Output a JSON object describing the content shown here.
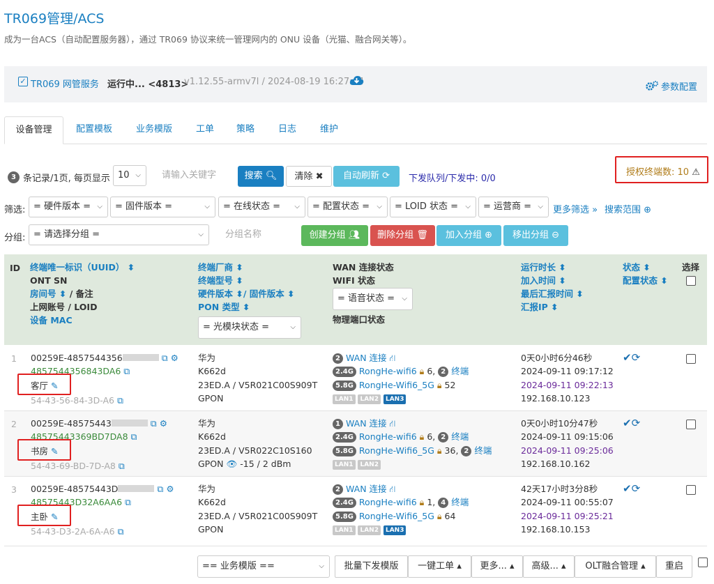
{
  "page": {
    "title": "TR069管理/ACS",
    "subtitle": "成为一台ACS（自动配置服务器），通过 TR069 协议来统一管理网内的 ONU 设备（光猫、融合网关等）。"
  },
  "service": {
    "name": "TR069 网管服务",
    "state": "运行中... <4813>",
    "version": "v1.12.55-armv7l / 2024-08-19 16:27:44",
    "param_label": "参数配置"
  },
  "tabs": [
    "设备管理",
    "配置模板",
    "业务模版",
    "工单",
    "策略",
    "日志",
    "维护"
  ],
  "toolbar": {
    "record_count": "3",
    "record_text": "条记录/1页, 每页显示",
    "page_size": "10",
    "keyword_placeholder": "请输入关键字",
    "search_label": "搜索",
    "clear_label": "清除",
    "auto_refresh_label": "自动刷新",
    "queue_label": "下发队列/下发中: 0/0",
    "license_label": "授权终端数: 10"
  },
  "filters": {
    "label": "筛选:",
    "hw": "= 硬件版本 =",
    "fw": "= 固件版本 =",
    "online": "= 在线状态 =",
    "config": "= 配置状态 =",
    "loid": "= LOID 状态 =",
    "isp": "= 运营商 =",
    "more": "更多筛选 »",
    "range": "搜索范围"
  },
  "groups": {
    "label": "分组:",
    "select": "= 请选择分组 =",
    "name_placeholder": "分组名称",
    "create": "创建分组",
    "delete": "删除分组",
    "join": "加入分组",
    "leave": "移出分组"
  },
  "header": {
    "id": "ID",
    "c1": [
      "终端唯一标识（UUID）",
      "ONT SN",
      "房间号",
      "/ 备注",
      "上网账号 / LOID",
      "设备 MAC"
    ],
    "c2": [
      "终端厂商",
      "终端型号",
      "硬件版本",
      "/ 固件版本",
      "PON 类型",
      "= 光模块状态 ="
    ],
    "c3": [
      "WAN 连接状态",
      "WIFI 状态",
      "= 语音状态 =",
      "物理端口状态"
    ],
    "c4": [
      "运行时长",
      "加入时间",
      "最后汇报时间",
      "汇报IP"
    ],
    "c5": [
      "状态",
      "配置状态"
    ],
    "select": "选择"
  },
  "rows": [
    {
      "idx": "1",
      "uuid": "00259E-4857544356",
      "sn": "4857544356843DA6",
      "room": "客厅",
      "mac": "54-43-56-84-3D-A6",
      "vendor": "华为",
      "model": "K662d",
      "ver": "23ED.A / V5R021C00S909T",
      "pon": "GPON",
      "wan_count": "2",
      "wan_label": "WAN 连接",
      "wifi24_ssid": "RongHe-wifi6",
      "wifi24_n": "6",
      "wifi24_term_n": "2",
      "term_label": "终端",
      "wifi5_ssid": "RongHe-Wifi6_5G",
      "wifi5_n": "52",
      "lans": [
        "LAN1",
        "LAN2",
        "LAN3"
      ],
      "lan_on": [
        false,
        false,
        true
      ],
      "uptime": "0天0小时6分46秒",
      "joined": "2024-09-11 09:17:12",
      "last": "2024-09-11 09:22:13",
      "ip": "192.168.10.123"
    },
    {
      "idx": "2",
      "uuid": "00259E-48575443",
      "sn": "48575443369BD7DA8",
      "room": "书房",
      "mac": "54-43-69-BD-7D-A8",
      "vendor": "华为",
      "model": "K662d",
      "ver": "23ED.A / V5R022C10S160",
      "pon": "GPON",
      "optical": "-15 / 2 dBm",
      "wan_count": "1",
      "wan_label": "WAN 连接",
      "wifi24_ssid": "RongHe-wifi6",
      "wifi24_n": "6",
      "wifi24_term_n": "2",
      "term_label": "终端",
      "wifi5_ssid": "RongHe-Wifi6_5G",
      "wifi5_n": "36",
      "wifi5_term_n": "2",
      "lans": [
        "LAN1",
        "LAN2"
      ],
      "lan_on": [
        false,
        false
      ],
      "uptime": "0天0小时10分47秒",
      "joined": "2024-09-11 09:15:06",
      "last": "2024-09-11 09:25:06",
      "ip": "192.168.10.162"
    },
    {
      "idx": "3",
      "uuid": "00259E-48575443D",
      "sn": "48575443D32A6AA6",
      "room": "主卧",
      "mac": "54-43-D3-2A-6A-A6",
      "vendor": "华为",
      "model": "K662d",
      "ver": "23ED.A / V5R021C00S909T",
      "pon": "GPON",
      "wan_count": "2",
      "wan_label": "WAN 连接",
      "wifi24_ssid": "RongHe-wifi6",
      "wifi24_n": "1",
      "wifi24_term_n": "4",
      "term_label": "终端",
      "wifi5_ssid": "RongHe-Wifi6_5G",
      "wifi5_n": "64",
      "lans": [
        "LAN1",
        "LAN2",
        "LAN3"
      ],
      "lan_on": [
        false,
        false,
        true
      ],
      "uptime": "42天17小时3分8秒",
      "joined": "2024-09-11 00:55:07",
      "last": "2024-09-11 09:25:21",
      "ip": "192.168.10.153"
    }
  ],
  "bands": {
    "b24": "2.4G",
    "b5": "5.8G"
  },
  "bottom": {
    "template_select": "== 业务模版 ==",
    "batch": "批量下发模版",
    "ticket": "一键工单",
    "more": "更多...",
    "advanced": "高级...",
    "olt": "OLT融合管理",
    "reboot": "重启"
  },
  "colors": {
    "accent": "#1a7fc1",
    "green_btn": "#5cb85c",
    "red_btn": "#d9534f",
    "info_btn": "#5bc0de",
    "primary_btn": "#1a7fc1"
  }
}
